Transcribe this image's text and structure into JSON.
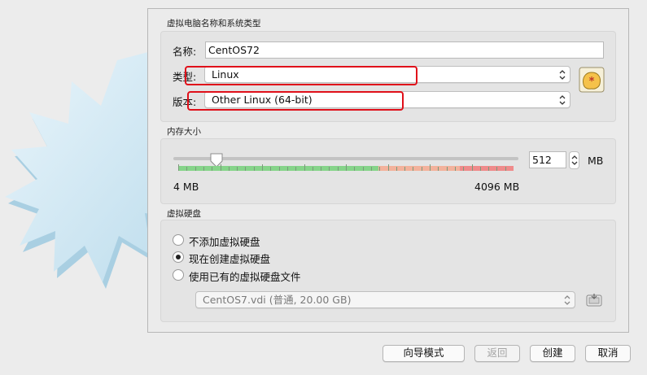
{
  "name_os": {
    "section_title": "虚拟电脑名称和系统类型",
    "name_label": "名称:",
    "name_value": "CentOS72",
    "type_label": "类型:",
    "type_value": "Linux",
    "version_label": "版本:",
    "version_value": "Other Linux (64-bit)"
  },
  "memory": {
    "section_title": "内存大小",
    "value": "512",
    "unit": "MB",
    "min_label": "4 MB",
    "max_label": "4096 MB",
    "slider_fraction": 0.125
  },
  "disk": {
    "section_title": "虚拟硬盘",
    "options": [
      {
        "label": "不添加虚拟硬盘",
        "checked": false
      },
      {
        "label": "现在创建虚拟硬盘",
        "checked": true
      },
      {
        "label": "使用已有的虚拟硬盘文件",
        "checked": false
      }
    ],
    "file_value": "CentOS7.vdi (普通, 20.00 GB)"
  },
  "buttons": {
    "guided": "向导模式",
    "back": "返回",
    "create": "创建",
    "cancel": "取消"
  },
  "colors": {
    "highlight": "#e0101a",
    "scale_green": "#86d48a",
    "scale_orange": "#f3b29c",
    "scale_red": "#ef8b8b"
  }
}
